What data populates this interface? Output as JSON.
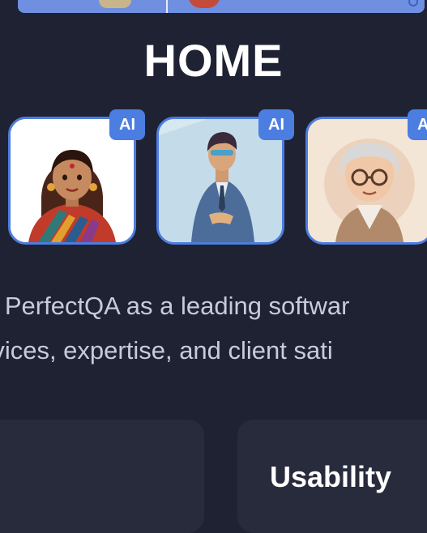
{
  "page": {
    "title": "HOME",
    "description_lines": [
      "e PerfectQA as a leading softwar",
      "rvices, expertise, and client sati"
    ]
  },
  "avatars": [
    {
      "name": "woman-saree-avatar",
      "badge": "AI",
      "background": "#ffffff"
    },
    {
      "name": "man-suit-avatar",
      "badge": "AI",
      "background": "#cfe3ee"
    },
    {
      "name": "elderly-woman-avatar",
      "badge": "AI",
      "background": "#f4e6d6"
    }
  ],
  "features": [
    {
      "title": ""
    },
    {
      "title": "Usability"
    }
  ],
  "colors": {
    "background": "#1e2233",
    "accent": "#4c7de0",
    "card": "#272b3c",
    "muted_text": "#c7ccd8"
  }
}
